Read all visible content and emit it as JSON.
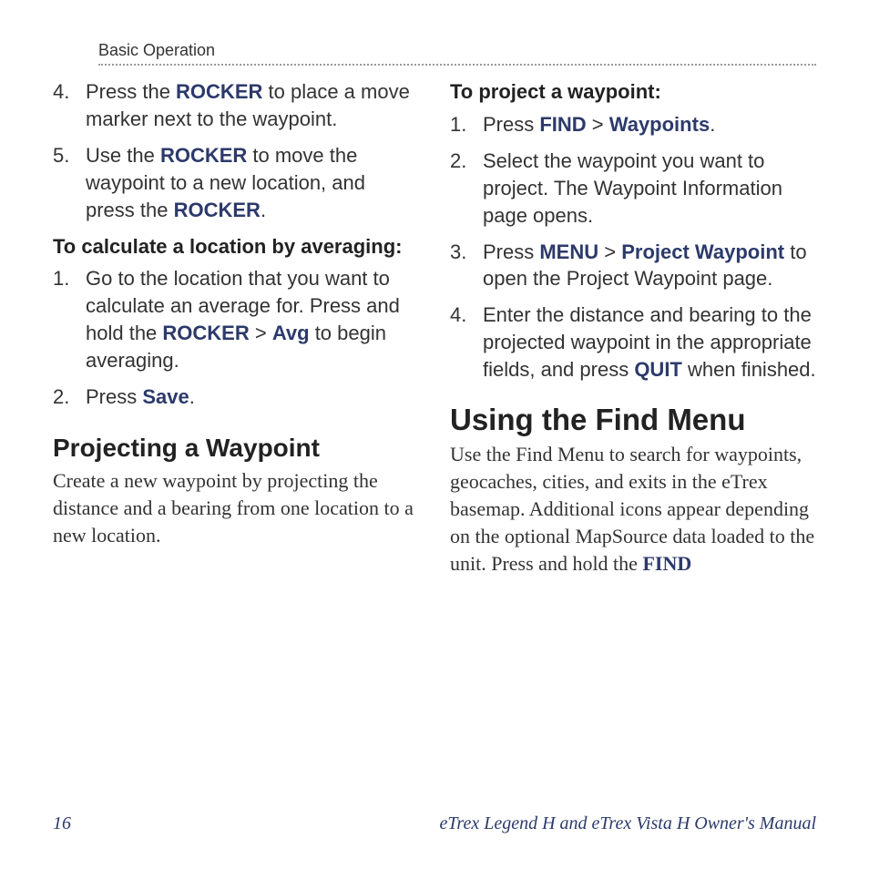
{
  "header": {
    "running": "Basic Operation"
  },
  "left": {
    "steps": [
      {
        "n": "4.",
        "pre": "Press the ",
        "kw1": "ROCKER",
        "post": " to place a move marker next to the waypoint."
      },
      {
        "n": "5.",
        "pre": "Use the ",
        "kw1": "ROCKER",
        "mid": " to move the waypoint to a new location, and press the ",
        "kw2": "ROCKER",
        "post": "."
      }
    ],
    "avg_head": "To calculate a location by averaging:",
    "avg_steps": [
      {
        "n": "1.",
        "pre": "Go to the location that you want to calculate an average for. Press and hold the ",
        "kw1": "ROCKER",
        "mid": " > ",
        "kw2": "Avg",
        "post": " to begin averaging."
      },
      {
        "n": "2.",
        "pre": "Press ",
        "kw1": "Save",
        "post": "."
      }
    ],
    "proj_head": "Projecting a Waypoint",
    "proj_body": "Create a new waypoint by projecting the distance and a bearing from one location to a new location."
  },
  "right": {
    "proj_to": "To project a waypoint:",
    "proj_steps": [
      {
        "n": "1.",
        "pre": "Press ",
        "kw1": "FIND",
        "mid": " > ",
        "kw2": "Waypoints",
        "post": "."
      },
      {
        "n": "2.",
        "pre": "Select the waypoint you want to project. The Waypoint Information page opens."
      },
      {
        "n": "3.",
        "pre": "Press ",
        "kw1": "MENU",
        "mid": " > ",
        "kw2": "Project Waypoint",
        "post": " to open the Project Waypoint page."
      },
      {
        "n": "4.",
        "pre": "Enter the distance and bearing to the projected waypoint in the appropriate fields, and press ",
        "kw1": "QUIT",
        "post": " when finished."
      }
    ],
    "find_head": "Using the Find Menu",
    "find_body_pre": "Use the Find Menu to search for waypoints, geocaches, cities, and exits in the eTrex basemap. Additional icons appear depending on the optional MapSource data loaded to the unit. Press and hold the ",
    "find_kw": "FIND"
  },
  "footer": {
    "page": "16",
    "title": "eTrex Legend H and eTrex Vista H Owner's Manual"
  }
}
